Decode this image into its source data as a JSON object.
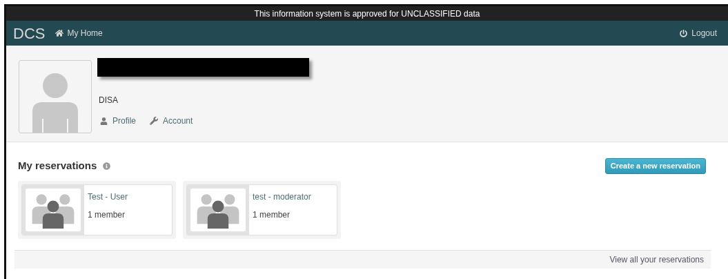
{
  "banner": "This information system is approved for UNCLASSIFIED data",
  "nav": {
    "brand": "DCS",
    "home": "My Home",
    "logout": "Logout"
  },
  "profile": {
    "organization": "DISA",
    "links": [
      "Profile",
      "Account"
    ]
  },
  "reservations": {
    "title": "My reservations",
    "create_button": "Create a new reservation",
    "items": [
      {
        "name": "Test - User",
        "members": "1 member"
      },
      {
        "name": "test - moderator",
        "members": "1 member"
      }
    ],
    "view_all": "View all your reservations"
  }
}
